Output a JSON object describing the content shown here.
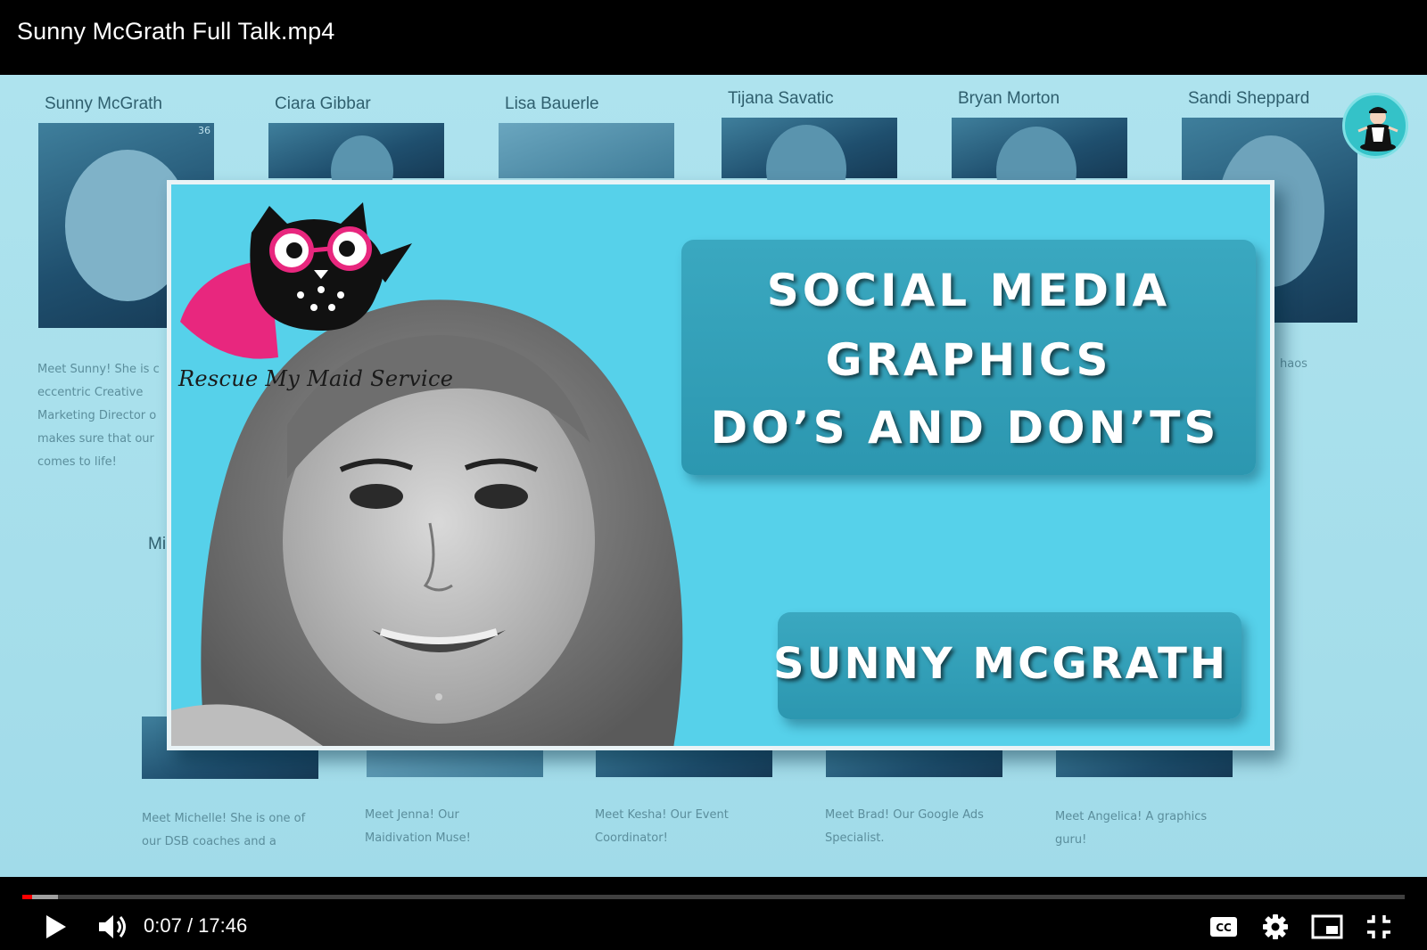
{
  "player": {
    "title": "Sunny McGrath Full Talk.mp4",
    "time_current": "0:07",
    "time_separator": " / ",
    "time_total": "17:46",
    "progress_played_fraction": 0.007,
    "progress_loaded_fraction": 0.026,
    "accent_color": "#ff0000"
  },
  "background_page": {
    "team_names": [
      "Sunny McGrath",
      "Ciara Gibbar",
      "Lisa Bauerle",
      "Tijana Savatic",
      "Bryan Morton",
      "Sandi Sheppard"
    ],
    "photo_badge": "36",
    "bio_sunny": [
      "Meet Sunny! She is c",
      "eccentric Creative",
      "Marketing Director o",
      "makes sure that our",
      "comes to life!"
    ],
    "partial_name": "Mi",
    "partial_bio_right": "haos",
    "bottom_bios": [
      [
        "Meet Michelle! She is one of",
        "our DSB coaches and a"
      ],
      [
        "Meet Jenna! Our",
        "Maidivation Muse!"
      ],
      [
        "Meet Kesha! Our Event",
        "Coordinator!"
      ],
      [
        "Meet Brad! Our Google Ads",
        "Specialist."
      ],
      [
        "Meet Angelica! A graphics",
        "guru!"
      ]
    ]
  },
  "title_card": {
    "headline_lines": [
      "SOCIAL MEDIA",
      "GRAPHICS",
      "DO’S AND DON’TS"
    ],
    "speaker": "SUNNY MCGRATH",
    "brand_text": "Rescue My Maid Service",
    "background_color": "#56d1ea"
  },
  "icons": {
    "play": "play-icon",
    "volume": "volume-icon",
    "captions": "closed-captions-icon",
    "settings": "gear-icon",
    "miniplayer": "miniplayer-icon",
    "exit_fullscreen": "exit-fullscreen-icon",
    "channel_avatar": "maid-avatar-icon"
  }
}
